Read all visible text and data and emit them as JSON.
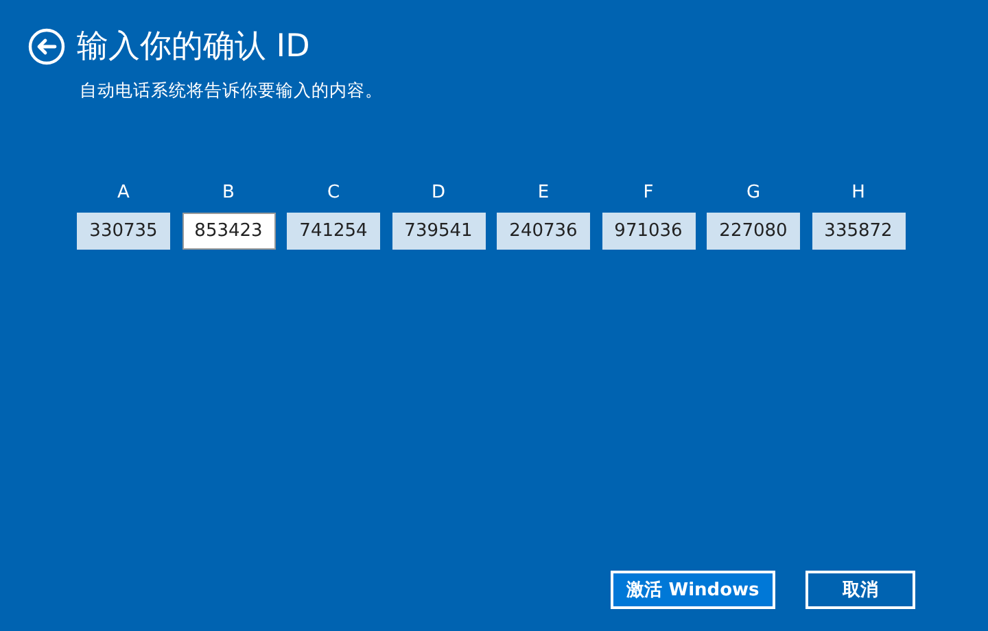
{
  "header": {
    "title": "输入你的确认 ID",
    "subtitle": "自动电话系统将告诉你要输入的内容。"
  },
  "fields": [
    {
      "label": "A",
      "value": "330735",
      "focused": false
    },
    {
      "label": "B",
      "value": "853423",
      "focused": true
    },
    {
      "label": "C",
      "value": "741254",
      "focused": false
    },
    {
      "label": "D",
      "value": "739541",
      "focused": false
    },
    {
      "label": "E",
      "value": "240736",
      "focused": false
    },
    {
      "label": "F",
      "value": "971036",
      "focused": false
    },
    {
      "label": "G",
      "value": "227080",
      "focused": false
    },
    {
      "label": "H",
      "value": "335872",
      "focused": false
    }
  ],
  "buttons": [
    {
      "label": "激活 Windows",
      "default": true
    },
    {
      "label": "取消",
      "default": false
    }
  ]
}
